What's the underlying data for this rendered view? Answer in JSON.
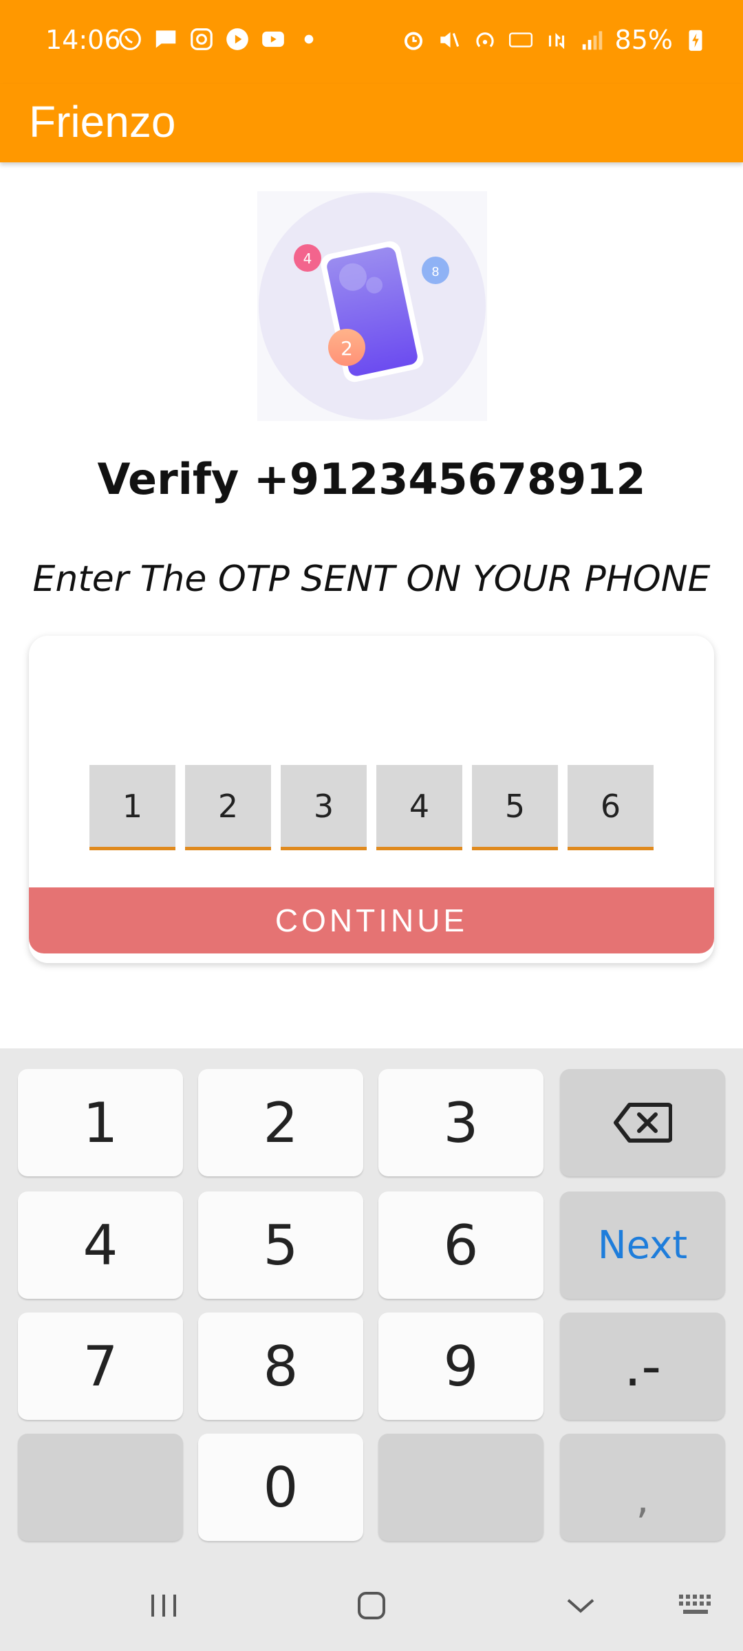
{
  "status": {
    "time": "14:06",
    "battery": "85%"
  },
  "app": {
    "title": "Frienzo"
  },
  "illustration": {
    "badges": [
      "4",
      "8",
      "2"
    ]
  },
  "verify": {
    "title": "Verify +912345678912",
    "instruction": "Enter The OTP SENT ON YOUR PHONE"
  },
  "otp": {
    "digits": [
      "1",
      "2",
      "3",
      "4",
      "5",
      "6"
    ]
  },
  "continue_label": "CONTINUE",
  "keyboard": {
    "k1": "1",
    "k2": "2",
    "k3": "3",
    "k4": "4",
    "k5": "5",
    "k6": "6",
    "k7": "7",
    "k8": "8",
    "k9": "9",
    "k0": "0",
    "next": "Next",
    "dotdash": ".-",
    "comma": ","
  },
  "colors": {
    "primary": "#ff9800",
    "button": "#e57373",
    "otp_underline": "#e08a1e",
    "key_accent": "#1e7ddb"
  }
}
